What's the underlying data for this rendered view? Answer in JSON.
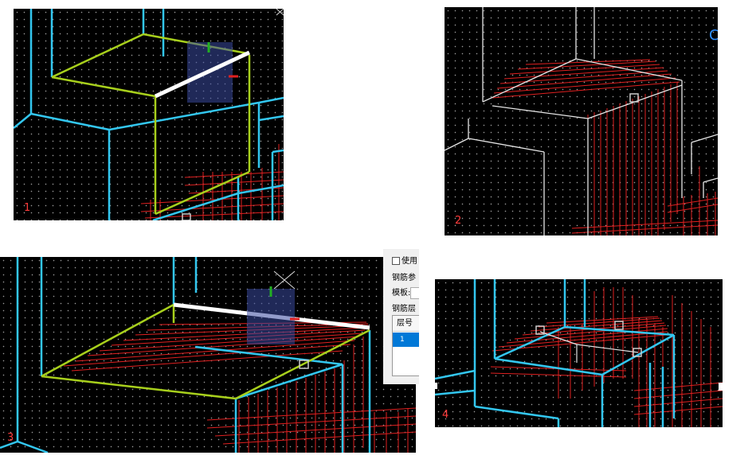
{
  "panels": [
    {
      "id": "p1",
      "label": "1"
    },
    {
      "id": "p2",
      "label": "2"
    },
    {
      "id": "p3",
      "label": "3"
    },
    {
      "id": "p4",
      "label": "4"
    }
  ],
  "dialog": {
    "use_checkbox_label": "使用",
    "rebar_params_label": "钢筋参",
    "template_label": "模板:",
    "rebar_layer_label": "钢筋层",
    "table_header_layer": "层号",
    "table_row_1": "1"
  },
  "panel2_edge_glyph": "C",
  "colors": {
    "viewport_bg": "#000000",
    "grid_dot": "#9a9a9a",
    "wire_cyan": "#33c7f0",
    "wire_white": "#e6e6e6",
    "selected_green": "#a8d01c",
    "rebar_red": "#e02020",
    "gizmo_blue": "#3a4aa0",
    "label_red": "#ff3b3b",
    "selection_blue": "#0078d7"
  }
}
